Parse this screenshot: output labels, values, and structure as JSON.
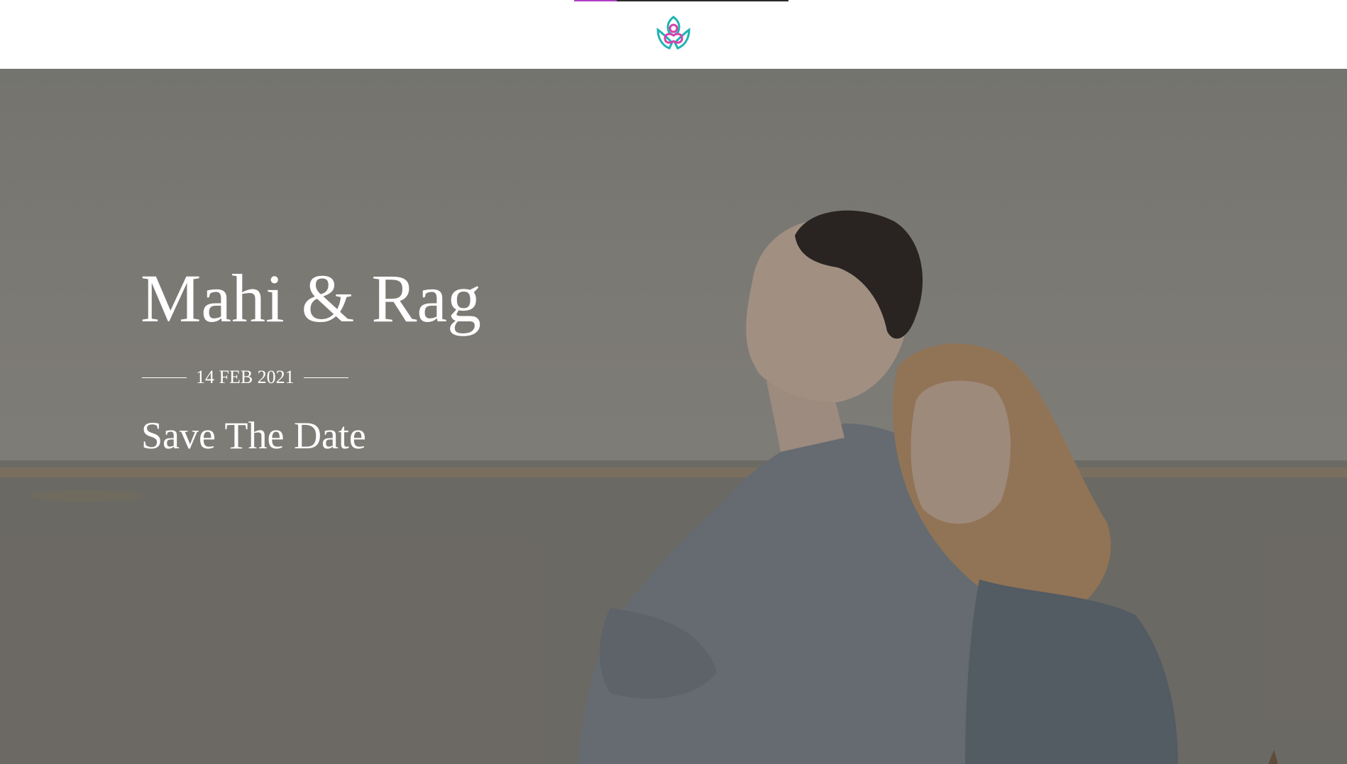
{
  "header": {
    "scroll_progress": 0.2,
    "logo_icon": "lotus-logo-icon",
    "logo_colors": {
      "teal": "#1fb3b4",
      "magenta": "#d93fa8"
    },
    "progress_colors": {
      "fill": "#b03ec4",
      "track": "#2a2a2a"
    }
  },
  "hero": {
    "couple_names": "Mahi & Rag",
    "date": "14 FEB 2021",
    "tagline": "Save The Date"
  }
}
